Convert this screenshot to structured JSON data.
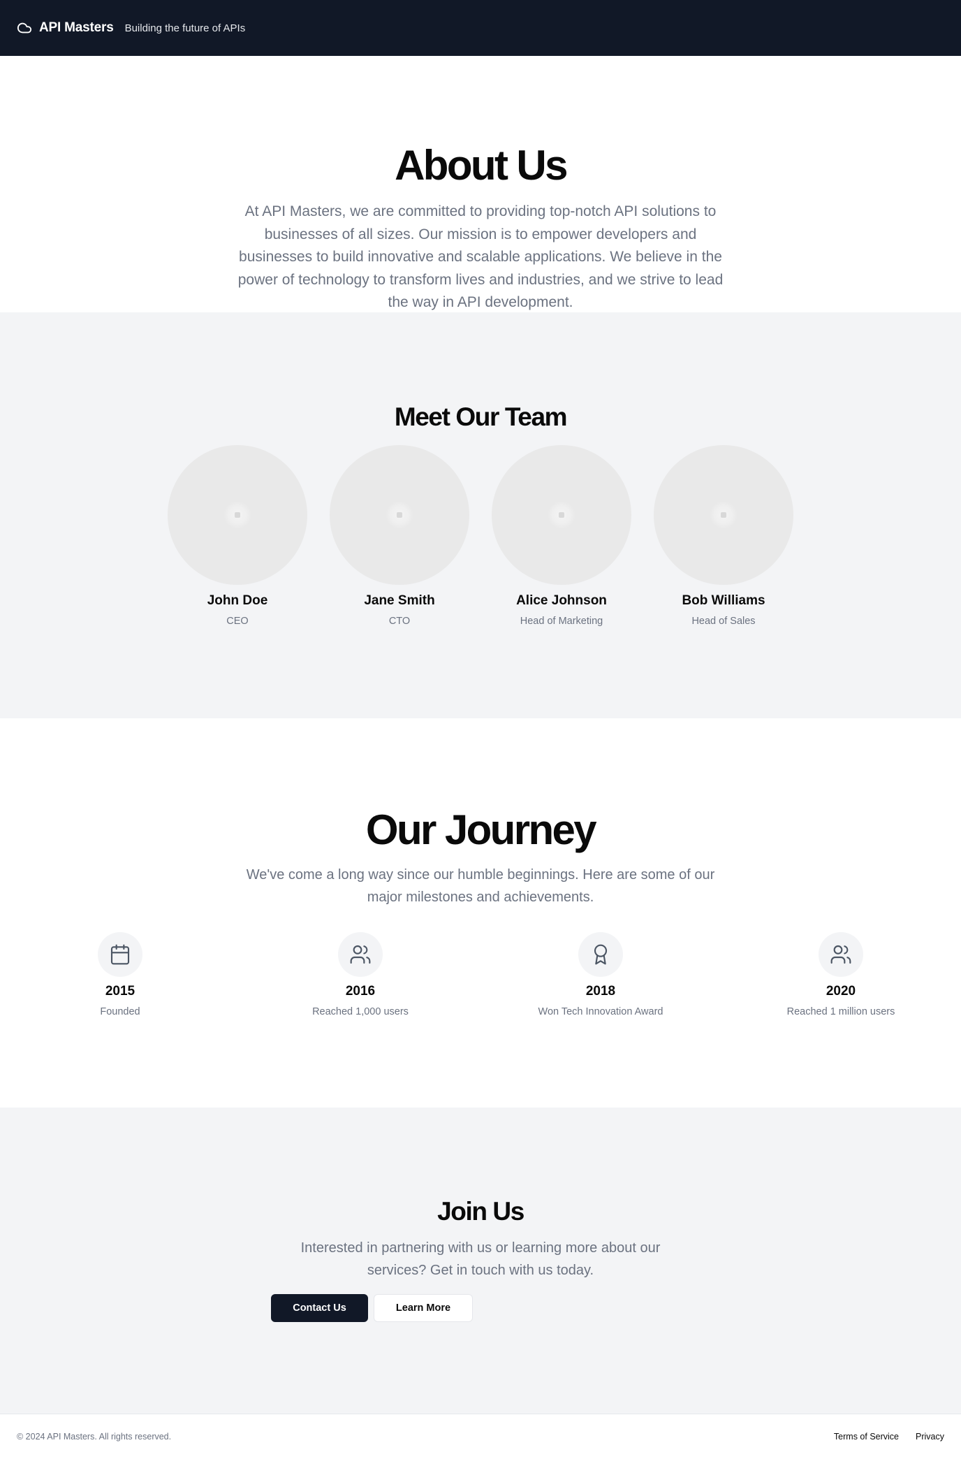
{
  "header": {
    "logo_icon": "cloud-icon",
    "brand": "API Masters",
    "tagline": "Building the future of APIs"
  },
  "about": {
    "title": "About Us",
    "body": "At API Masters, we are committed to providing top-notch API solutions to businesses of all sizes. Our mission is to empower developers and businesses to build innovative and scalable applications. We believe in the power of technology to transform lives and industries, and we strive to lead the way in API development."
  },
  "team": {
    "title": "Meet Our Team",
    "members": [
      {
        "name": "John Doe",
        "role": "CEO"
      },
      {
        "name": "Jane Smith",
        "role": "CTO"
      },
      {
        "name": "Alice Johnson",
        "role": "Head of Marketing"
      },
      {
        "name": "Bob Williams",
        "role": "Head of Sales"
      }
    ]
  },
  "journey": {
    "title": "Our Journey",
    "body": "We've come a long way since our humble beginnings. Here are some of our major milestones and achievements.",
    "milestones": [
      {
        "year": "2015",
        "label": "Founded",
        "icon": "calendar-icon"
      },
      {
        "year": "2016",
        "label": "Reached 1,000 users",
        "icon": "users-icon"
      },
      {
        "year": "2018",
        "label": "Won Tech Innovation Award",
        "icon": "award-icon"
      },
      {
        "year": "2020",
        "label": "Reached 1 million users",
        "icon": "users-icon"
      }
    ]
  },
  "join": {
    "title": "Join Us",
    "body": "Interested in partnering with us or learning more about our services? Get in touch with us today.",
    "primary_button": "Contact Us",
    "secondary_button": "Learn More"
  },
  "footer": {
    "copyright": "© 2024 API Masters. All rights reserved.",
    "links": [
      "Terms of Service",
      "Privacy"
    ]
  },
  "colors": {
    "header_bg": "#111827",
    "section_alt_bg": "#f3f4f6",
    "muted_text": "#6b7280",
    "primary_button_bg": "#111827"
  }
}
